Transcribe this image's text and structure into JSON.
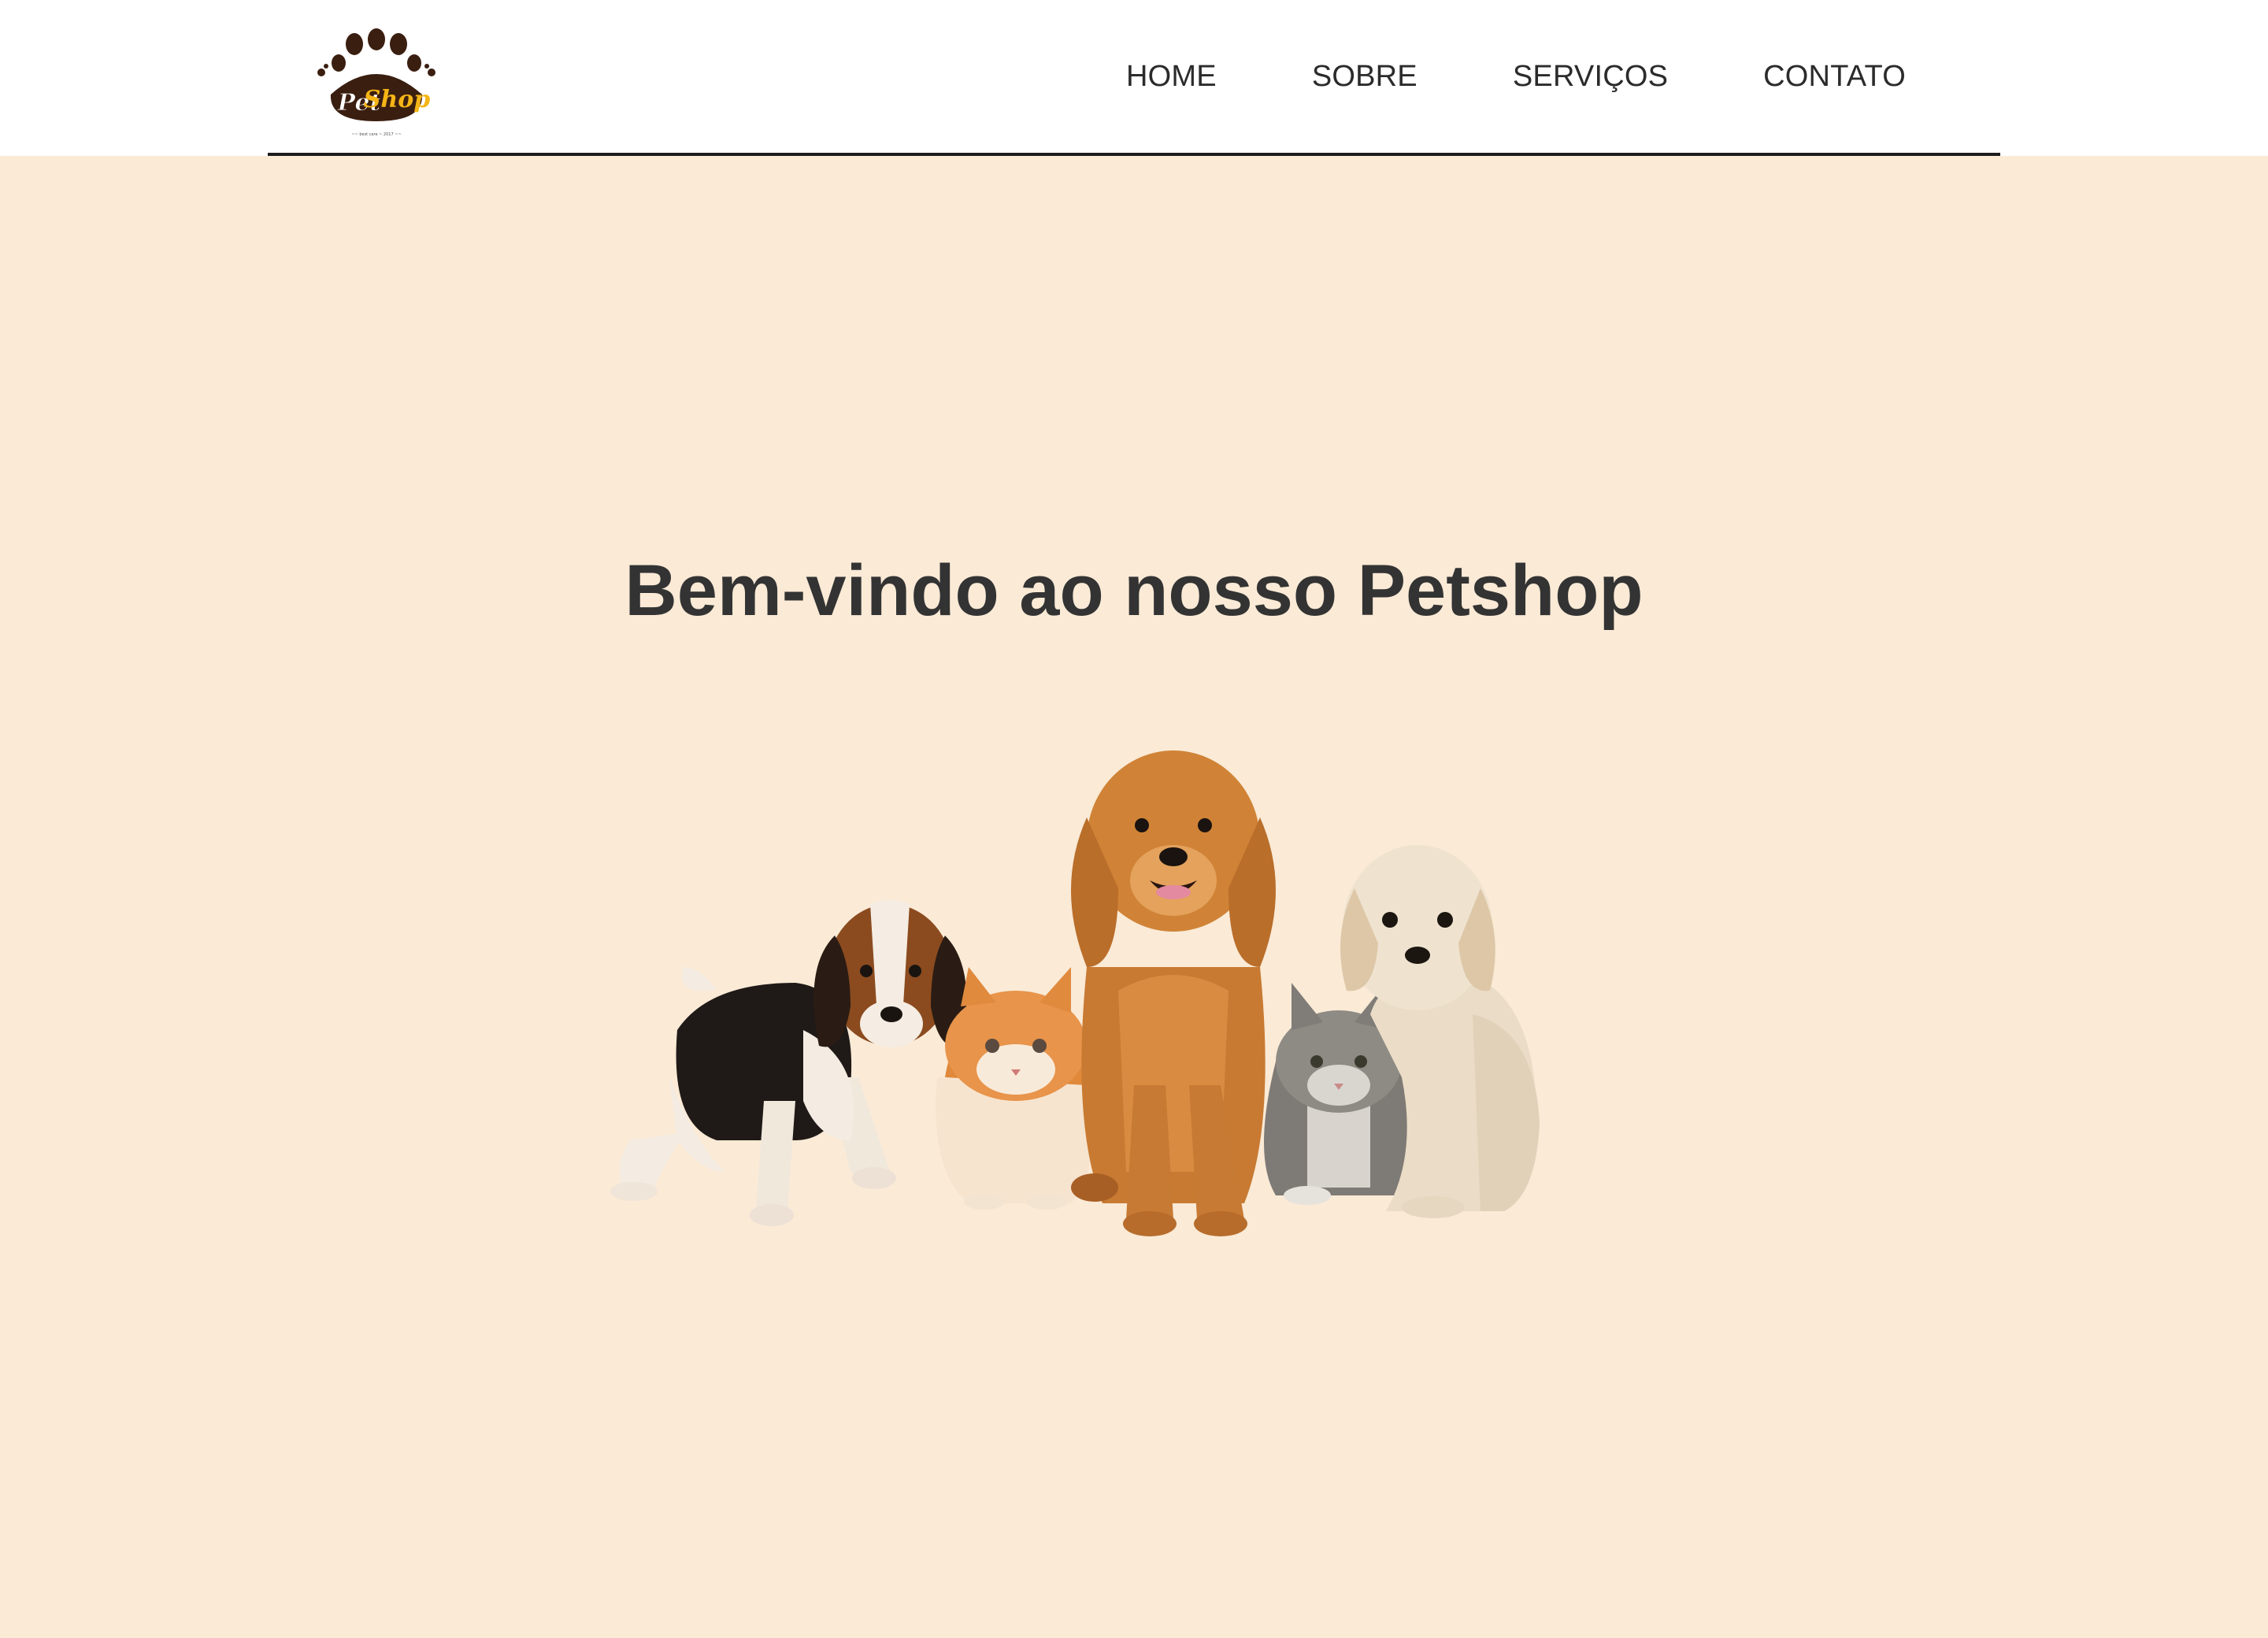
{
  "header": {
    "logo": {
      "text_part1": "Pet",
      "text_part2": "Shop",
      "tagline": "~~ best care ~ 2017 ~~"
    },
    "nav": [
      {
        "label": "HOME"
      },
      {
        "label": "SOBRE"
      },
      {
        "label": "SERVIÇOS"
      },
      {
        "label": "CONTATO"
      }
    ]
  },
  "hero": {
    "title": "Bem-vindo ao nosso Petshop",
    "image_subject": "group of puppies and kittens"
  },
  "colors": {
    "background": "#faead6",
    "header_bg": "#ffffff",
    "text": "#333333",
    "logo_brown": "#3a1e10",
    "logo_yellow": "#f5b516"
  }
}
